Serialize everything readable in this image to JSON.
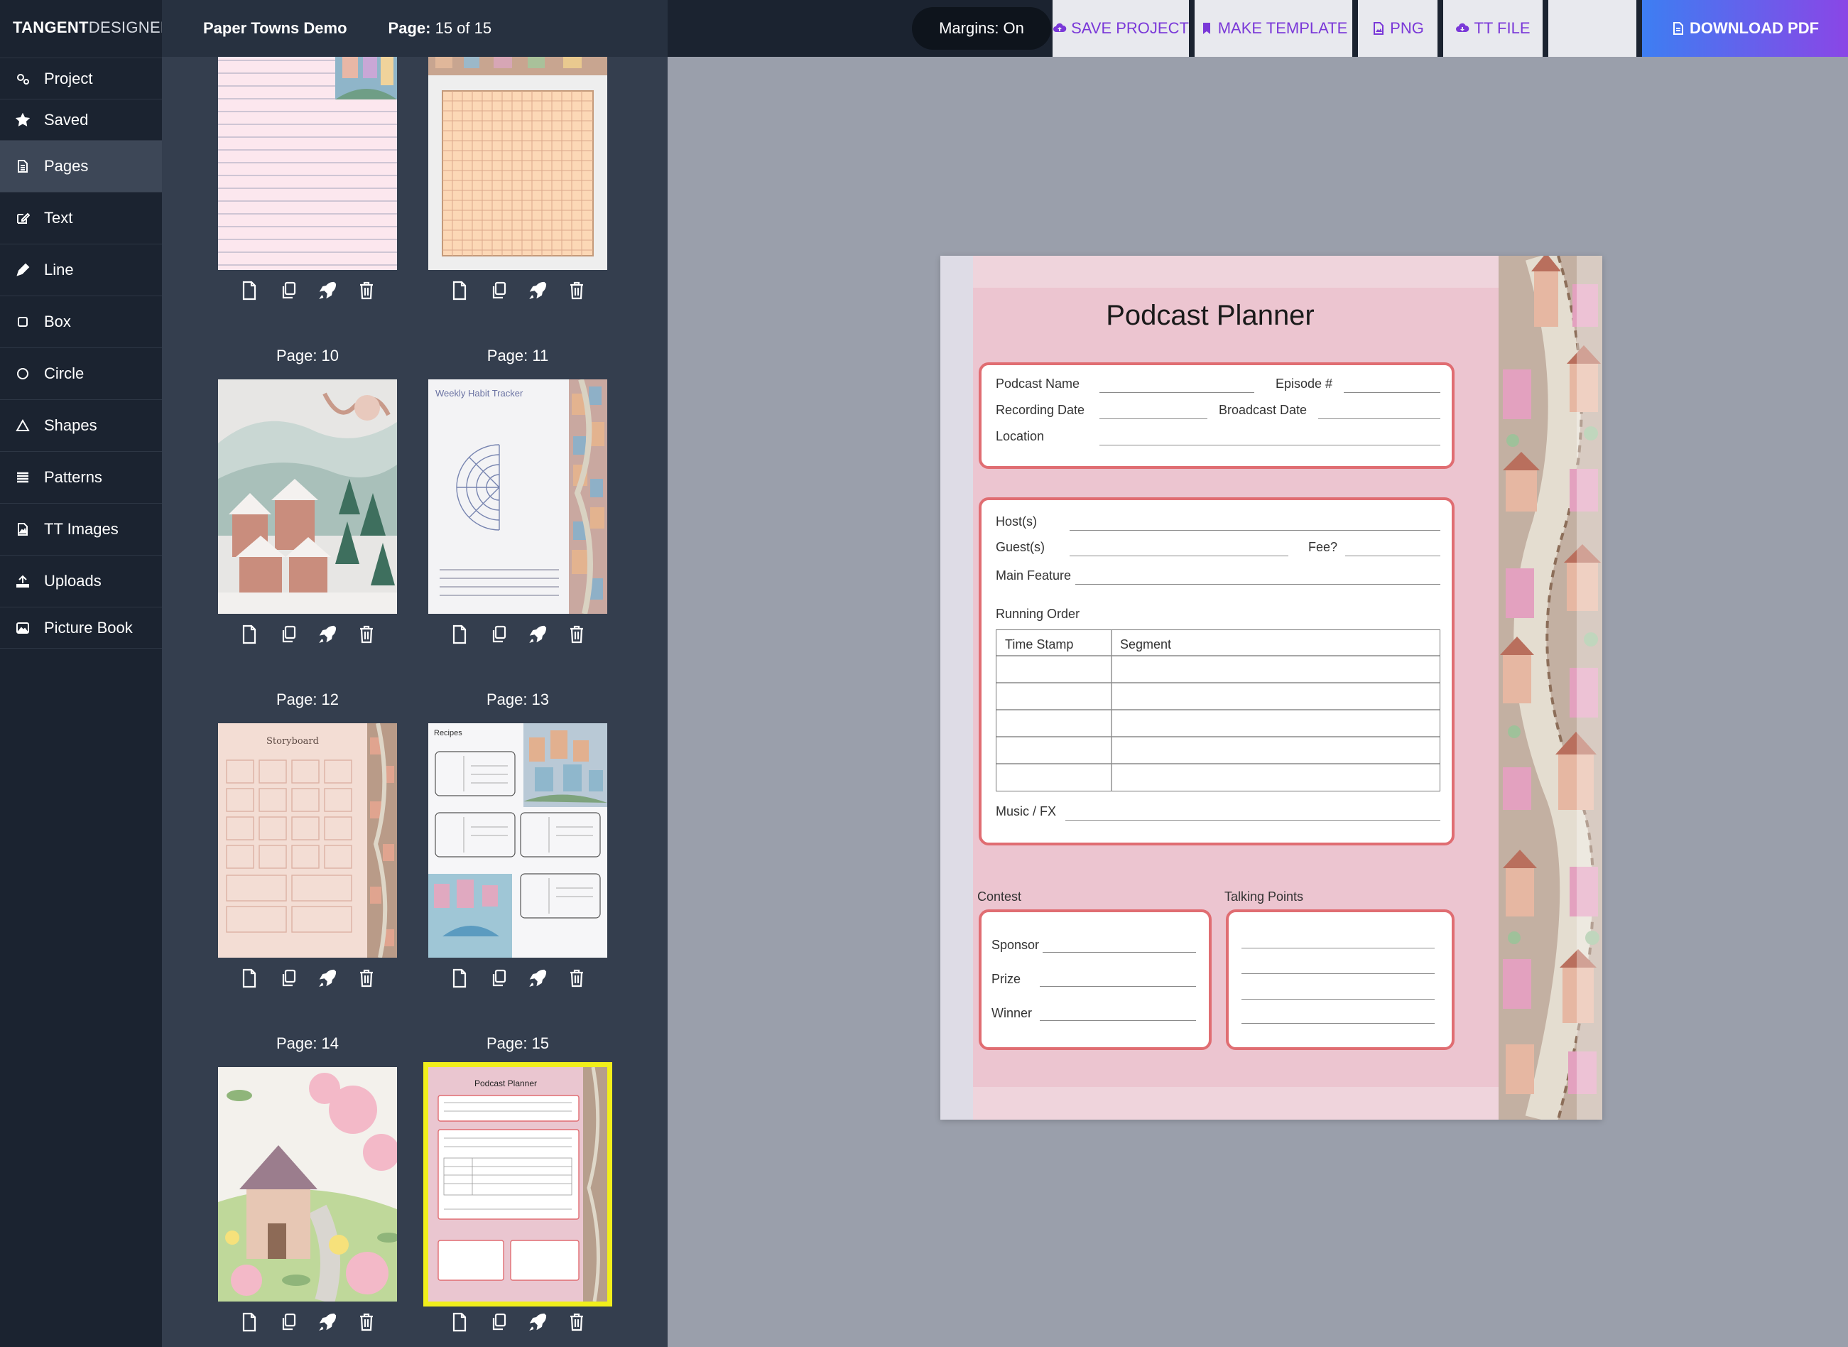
{
  "brand": {
    "name_bold": "TANGENT",
    "name_light": "DESIGNER"
  },
  "nav": [
    {
      "label": "Project",
      "icon": "gears-icon"
    },
    {
      "label": "Saved",
      "icon": "star-icon"
    },
    {
      "label": "Pages",
      "icon": "page-icon",
      "active": true
    },
    {
      "label": "Text",
      "icon": "edit-text-icon"
    },
    {
      "label": "Line",
      "icon": "pencil-icon"
    },
    {
      "label": "Box",
      "icon": "square-icon"
    },
    {
      "label": "Circle",
      "icon": "circle-icon"
    },
    {
      "label": "Shapes",
      "icon": "triangle-icon"
    },
    {
      "label": "Patterns",
      "icon": "patterns-icon"
    },
    {
      "label": "TT Images",
      "icon": "image-file-icon"
    },
    {
      "label": "Uploads",
      "icon": "upload-icon"
    },
    {
      "label": "Picture Book",
      "icon": "picture-icon"
    }
  ],
  "panel": {
    "project_name": "Paper Towns Demo",
    "page_prefix": "Page:",
    "page_indicator": "15 of 15"
  },
  "pages": [
    {
      "label": "",
      "style": "lined-pink"
    },
    {
      "label": "",
      "style": "grid-orange"
    },
    {
      "label": "Page: 10",
      "style": "winter-village"
    },
    {
      "label": "Page: 11",
      "style": "habit-tracker",
      "caption": "Weekly Habit Tracker"
    },
    {
      "label": "Page: 12",
      "style": "storyboard",
      "caption": "Storyboard"
    },
    {
      "label": "Page: 13",
      "style": "recipes",
      "caption": "Recipes"
    },
    {
      "label": "Page: 14",
      "style": "flower-cottage"
    },
    {
      "label": "Page: 15",
      "style": "podcast",
      "caption": "Podcast Planner",
      "selected": true
    }
  ],
  "page_actions": [
    "new-page-icon",
    "duplicate-icon",
    "rocket-icon",
    "trash-icon"
  ],
  "toolbar": {
    "margins": "Margins: On",
    "save": "SAVE PROJECT",
    "template": "MAKE TEMPLATE",
    "png": "PNG",
    "ttfile": "TT FILE",
    "download": "DOWNLOAD PDF"
  },
  "planner": {
    "title": "Podcast Planner",
    "podcast_name": "Podcast Name",
    "episode": "Episode #",
    "recording_date": "Recording Date",
    "broadcast_date": "Broadcast Date",
    "location": "Location",
    "hosts": "Host(s)",
    "guests": "Guest(s)",
    "fee": "Fee?",
    "main_feature": "Main Feature",
    "running_order": "Running Order",
    "col_time": "Time Stamp",
    "col_segment": "Segment",
    "music": "Music / FX",
    "contest": "Contest",
    "talking_points": "Talking Points",
    "sponsor": "Sponsor",
    "prize": "Prize",
    "winner": "Winner"
  },
  "colors": {
    "accent": "#7a38d8",
    "frame": "#e06d72",
    "sheet_pink": "#ecc5d0",
    "selected_outline": "#f1ee1b",
    "nav_bg": "#1b2330",
    "panel_bg": "#343e4e"
  }
}
